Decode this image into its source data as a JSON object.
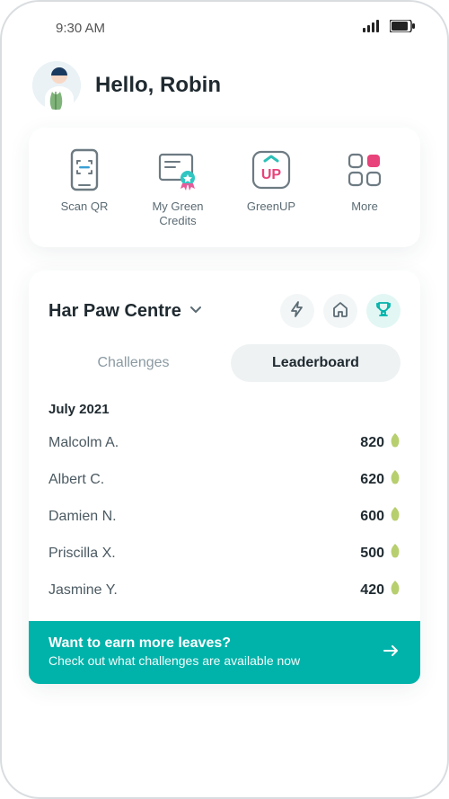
{
  "status": {
    "time": "9:30 AM"
  },
  "greeting": "Hello, Robin",
  "quick_actions": [
    {
      "label": "Scan QR"
    },
    {
      "label": "My Green Credits"
    },
    {
      "label": "GreenUP"
    },
    {
      "label": "More"
    }
  ],
  "centre": {
    "name": "Har Paw Centre"
  },
  "tabs": {
    "challenges": "Challenges",
    "leaderboard": "Leaderboard"
  },
  "leaderboard": {
    "period": "July 2021",
    "entries": [
      {
        "name": "Malcolm A.",
        "score": "820"
      },
      {
        "name": "Albert C.",
        "score": "620"
      },
      {
        "name": "Damien N.",
        "score": "600"
      },
      {
        "name": "Priscilla X.",
        "score": "500"
      },
      {
        "name": "Jasmine Y.",
        "score": "420"
      }
    ]
  },
  "cta": {
    "title": "Want to earn more leaves?",
    "subtitle": "Check out what challenges are available now"
  },
  "colors": {
    "accent": "#00b3aa"
  }
}
